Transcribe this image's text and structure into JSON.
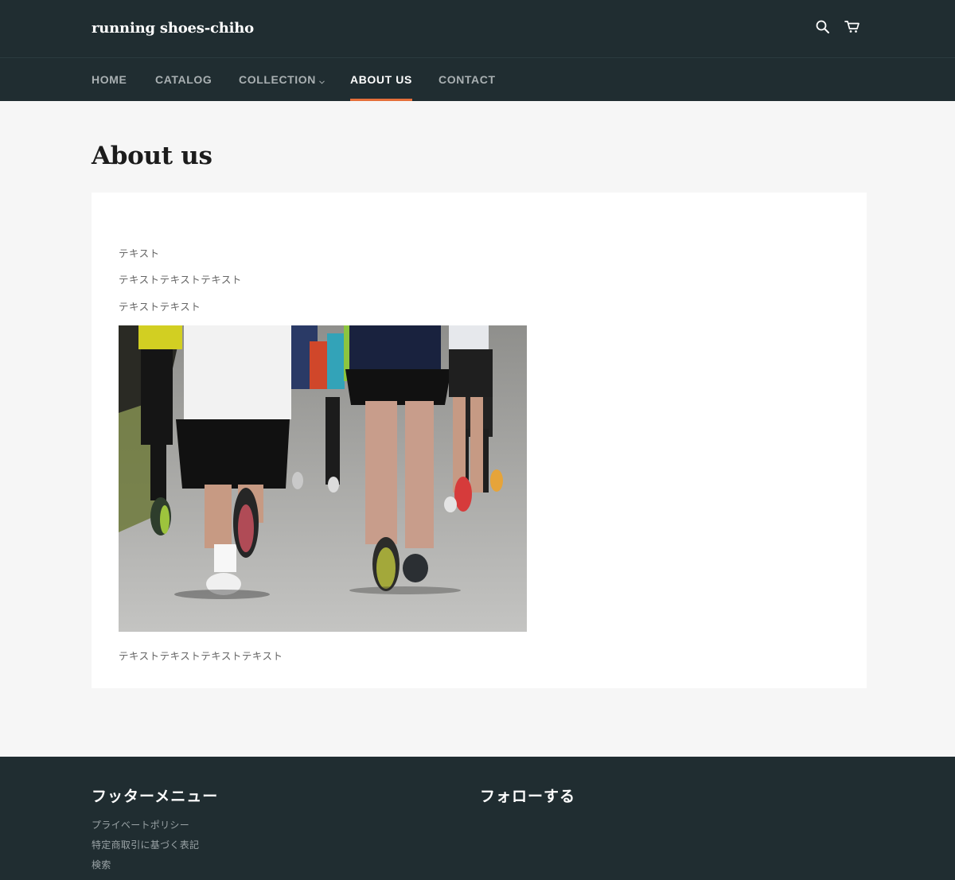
{
  "header": {
    "brand": "running shoes-chiho",
    "icons": [
      "search-icon",
      "cart-icon"
    ]
  },
  "nav": {
    "items": [
      {
        "label": "HOME"
      },
      {
        "label": "CATALOG"
      },
      {
        "label": "COLLECTION"
      },
      {
        "label": "ABOUT US"
      },
      {
        "label": "CONTACT"
      }
    ],
    "active": "ABOUT US",
    "active_color": "#e56f3a"
  },
  "main": {
    "title": "About us",
    "paragraphs": [
      "テキスト",
      "テキストテキストテキスト",
      "テキストテキスト",
      "テキストテキストテキストテキスト"
    ]
  },
  "footer": {
    "menu_heading": "フッターメニュー",
    "follow_heading": "フォローする",
    "links": [
      "プライベートポリシー",
      "特定商取引に基づく表記",
      "検索"
    ]
  },
  "colors": {
    "header_bg": "#202d31",
    "page_bg": "#f6f6f6",
    "accent": "#e56f3a"
  }
}
